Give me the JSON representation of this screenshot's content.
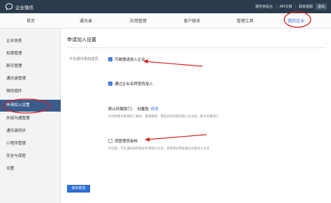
{
  "app": {
    "title": "企业微信"
  },
  "top_links": {
    "service": "服务商后台",
    "api": "API文档",
    "contact": "联系客服",
    "exit": "退出"
  },
  "nav": {
    "items": [
      "首页",
      "通讯录",
      "应用管理",
      "客户联系",
      "管理工具",
      "我的企业"
    ],
    "active": "我的企业"
  },
  "sidebar": {
    "items": [
      "企业信息",
      "权限管理",
      "聊天管理",
      "通讯录管理",
      "微信插件",
      "申请加入设置",
      "外部沟通管理",
      "通讯录同步",
      "小程序管理",
      "安全与保密",
      "设置"
    ],
    "active": "申请加入设置"
  },
  "main": {
    "title": "申请加入设置",
    "row_label": "不在通讯录的成员",
    "option_invite": {
      "label": "可被邀请加入企业",
      "checked": true
    },
    "option_search": {
      "label": "通过企业名称查找加入",
      "checked": true
    },
    "dept": {
      "prefix": "默认所属部门：",
      "value": "向量鱼",
      "edit": "修改",
      "desc": "识别你性名管理的二维码、邀请链接、或成员找到查找加入企业后，默认所属部门"
    },
    "option_review": {
      "label": "须管理员审核",
      "checked": false,
      "desc": "开启后，不在通讯录的成员申请加入企业，须管理员审核通过才能加入企业"
    },
    "save_label": "保存更改"
  },
  "colors": {
    "topbar": "#2b3b4d",
    "accent": "#2f6fd6",
    "sidebar_active": "#395c8d",
    "annotation": "#d92020"
  }
}
